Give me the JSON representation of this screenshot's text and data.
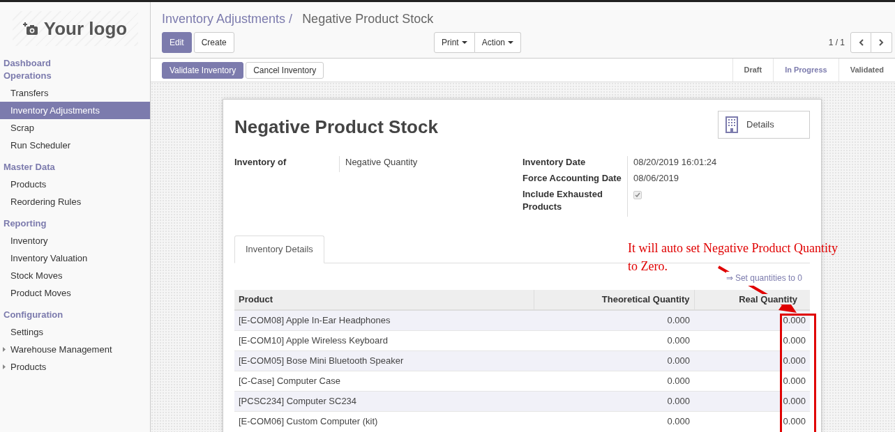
{
  "logo": {
    "text": "Your logo"
  },
  "sidebar": {
    "items": [
      {
        "kind": "header",
        "label": "Dashboard",
        "selected": false
      },
      {
        "kind": "header",
        "label": "Operations",
        "selected": false
      },
      {
        "kind": "link",
        "label": "Transfers",
        "selected": false
      },
      {
        "kind": "link",
        "label": "Inventory Adjustments",
        "selected": true
      },
      {
        "kind": "link",
        "label": "Scrap",
        "selected": false
      },
      {
        "kind": "link",
        "label": "Run Scheduler",
        "selected": false
      },
      {
        "kind": "header",
        "label": "Master Data",
        "selected": false
      },
      {
        "kind": "link",
        "label": "Products",
        "selected": false
      },
      {
        "kind": "link",
        "label": "Reordering Rules",
        "selected": false
      },
      {
        "kind": "header",
        "label": "Reporting",
        "selected": false
      },
      {
        "kind": "link",
        "label": "Inventory",
        "selected": false
      },
      {
        "kind": "link",
        "label": "Inventory Valuation",
        "selected": false
      },
      {
        "kind": "link",
        "label": "Stock Moves",
        "selected": false
      },
      {
        "kind": "link",
        "label": "Product Moves",
        "selected": false
      },
      {
        "kind": "header",
        "label": "Configuration",
        "selected": false
      },
      {
        "kind": "link",
        "label": "Settings",
        "selected": false
      },
      {
        "kind": "folder",
        "label": "Warehouse Management",
        "selected": false
      },
      {
        "kind": "folder",
        "label": "Products",
        "selected": false
      }
    ]
  },
  "breadcrumb": {
    "parent": "Inventory Adjustments",
    "separator": "/",
    "current": "Negative Product Stock"
  },
  "buttons": [
    {
      "label": "Edit",
      "kind": "primary"
    },
    {
      "label": "Create",
      "kind": "secondary"
    }
  ],
  "dropdowns": [
    "Print",
    "Action"
  ],
  "pager": {
    "text": "1 / 1"
  },
  "header_buttons": [
    {
      "label": "Validate Inventory",
      "kind": "primary"
    },
    {
      "label": "Cancel Inventory",
      "kind": "secondary"
    }
  ],
  "stages": [
    {
      "label": "Draft",
      "selected": false
    },
    {
      "label": "In Progress",
      "selected": true
    },
    {
      "label": "Validated",
      "selected": false
    }
  ],
  "form": {
    "title": "Negative Product Stock",
    "details_button": "Details",
    "fields_left": [
      {
        "label": "Inventory of",
        "kind": "text",
        "value": "Negative Quantity"
      }
    ],
    "fields_right": [
      {
        "label": "Inventory Date",
        "kind": "text",
        "value": "08/20/2019 16:01:24"
      },
      {
        "label": "Force Accounting Date",
        "kind": "text",
        "value": "08/06/2019"
      },
      {
        "label": "Include Exhausted Products",
        "kind": "checkbox",
        "checked": true
      }
    ]
  },
  "tabs": [
    {
      "label": "Inventory Details",
      "selected": true
    }
  ],
  "set_quantities_link": "⇒ Set quantities to 0",
  "table": {
    "columns": [
      "Product",
      "Theoretical Quantity",
      "Real Quantity"
    ],
    "rows": [
      [
        "[E-COM08] Apple In-Ear Headphones",
        "0.000",
        "0.000"
      ],
      [
        "[E-COM10] Apple Wireless Keyboard",
        "0.000",
        "0.000"
      ],
      [
        "[E-COM05] Bose Mini Bluetooth Speaker",
        "0.000",
        "0.000"
      ],
      [
        "[C-Case] Computer Case",
        "0.000",
        "0.000"
      ],
      [
        "[PCSC234] Computer SC234",
        "0.000",
        "0.000"
      ],
      [
        "[E-COM06] Custom Computer (kit)",
        "0.000",
        "0.000"
      ]
    ]
  },
  "annotation": {
    "text": "It will auto set Negative Product Quantity to Zero."
  }
}
